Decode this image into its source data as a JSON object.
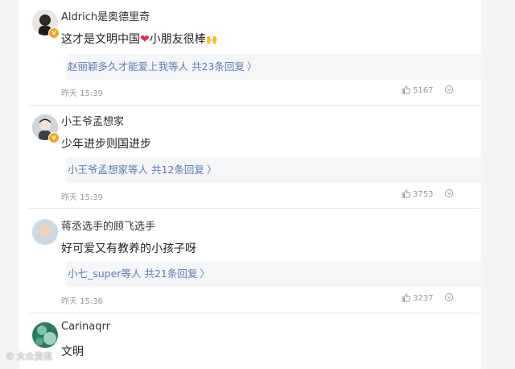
{
  "comments": [
    {
      "username": "Aldrich是奥德里奇",
      "text_before": "这才是文明中国",
      "text_after": "小朋友很棒",
      "emoji_heart": "❤",
      "emoji_hands": "🙌",
      "reply_users": "赵丽颖多久才能爱上我等人",
      "reply_count": "共23条回复",
      "time": "昨天 15:39",
      "likes": "5167"
    },
    {
      "username": "小王爷孟想家",
      "text": "少年进步则国进步",
      "reply_users": "小王爷孟想家等人",
      "reply_count": "共12条回复",
      "time": "昨天 15:39",
      "likes": "3753"
    },
    {
      "username": "蒋丞选手的顾飞选手",
      "text": "好可爱又有教养的小孩子呀",
      "reply_users": "小七_super等人",
      "reply_count": "共21条回复",
      "time": "昨天 15:36",
      "likes": "3237"
    },
    {
      "username": "Carinaqrr",
      "text": "文明"
    }
  ],
  "icons": {
    "reply_chevron": "chevron-right-icon",
    "like": "thumbs-up-icon",
    "more": "circle-options-icon"
  },
  "colors": {
    "link": "#5a7db3",
    "badge": "#f6a623",
    "heart": "#e0304e",
    "reply_bg": "#f5f6f8"
  },
  "watermark": "大众资讯"
}
